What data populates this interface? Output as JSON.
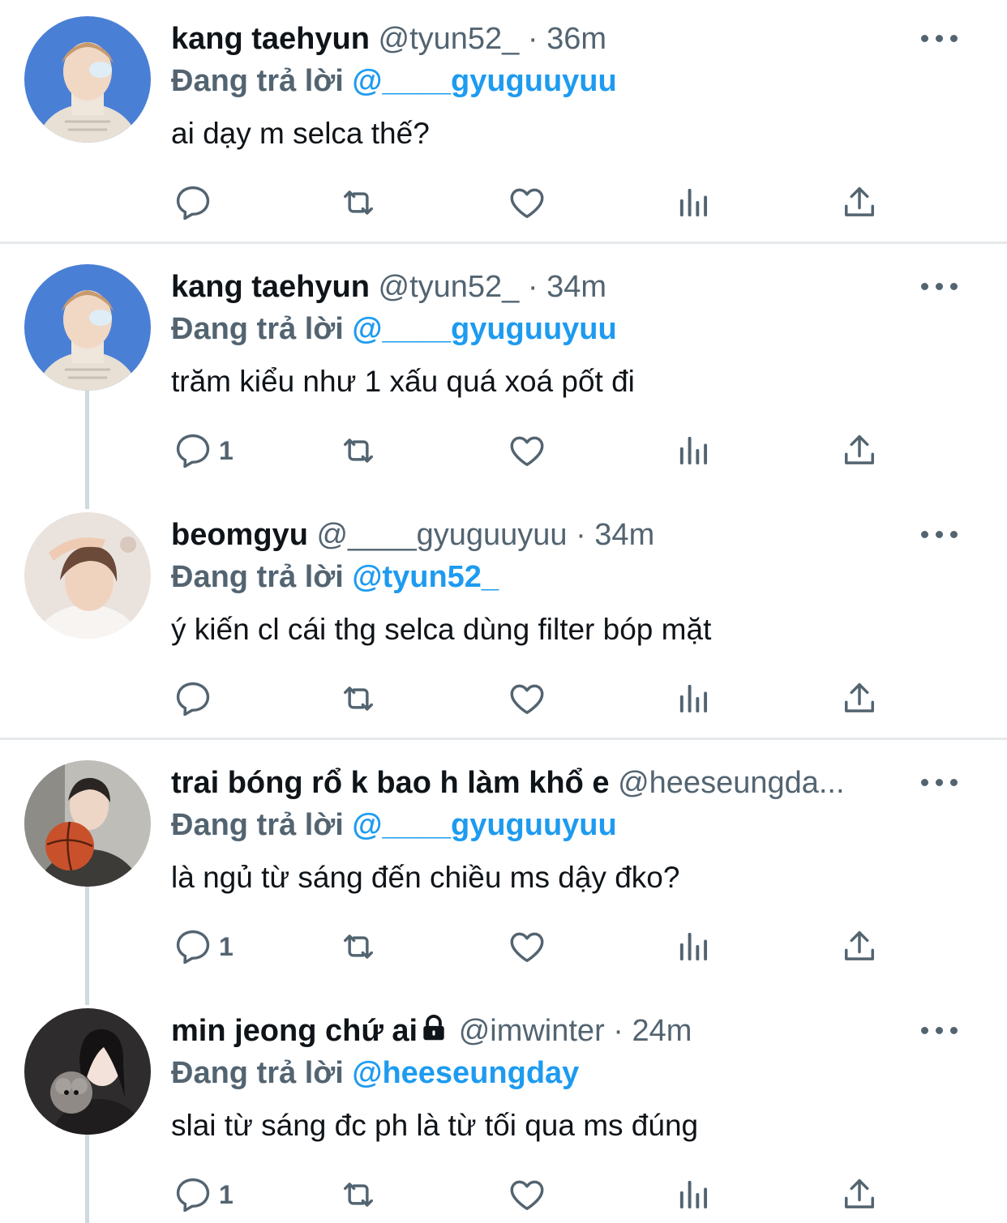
{
  "tweets": [
    {
      "name": "kang taehyun",
      "handle": "@tyun52_",
      "time": "36m",
      "replying_label": "Đang trả lời",
      "replying_to": "@____gyuguuyuu",
      "text": "ai dạy m selca thế?",
      "reply_count": ""
    },
    {
      "name": "kang taehyun",
      "handle": "@tyun52_",
      "time": "34m",
      "replying_label": "Đang trả lời",
      "replying_to": "@____gyuguuyuu",
      "text": "trăm kiểu như 1 xấu quá xoá pốt đi",
      "reply_count": "1"
    },
    {
      "name": "beomgyu",
      "handle": "@____gyuguuyuu",
      "time": "34m",
      "replying_label": "Đang trả lời",
      "replying_to": "@tyun52_",
      "text": "ý kiến cl cái thg selca dùng filter bóp mặt",
      "reply_count": ""
    },
    {
      "name": "trai bóng rổ k bao h làm khổ e",
      "handle": "@heeseungda...",
      "time": "",
      "replying_label": "Đang trả lời",
      "replying_to": "@____gyuguuyuu",
      "text": "là ngủ từ sáng đến chiều ms dậy đko?",
      "reply_count": "1"
    },
    {
      "name": "min jeong chứ ai",
      "handle": "@imwinter",
      "time": "24m",
      "replying_label": "Đang trả lời",
      "replying_to": "@heeseungday",
      "text": "slai từ sáng đc ph là từ tối qua ms đúng",
      "reply_count": "1"
    }
  ],
  "separator_dot": "·",
  "icons": {
    "reply": "reply-icon",
    "retweet": "retweet-icon",
    "like": "like-icon",
    "views": "views-icon",
    "share": "share-icon",
    "more": "more-icon",
    "lock": "lock-icon"
  },
  "colors": {
    "accent": "#1d9bf0",
    "text_primary": "#0f1419",
    "text_secondary": "#536471",
    "divider": "#e6e9eb",
    "thread_line": "#cfd9de"
  }
}
